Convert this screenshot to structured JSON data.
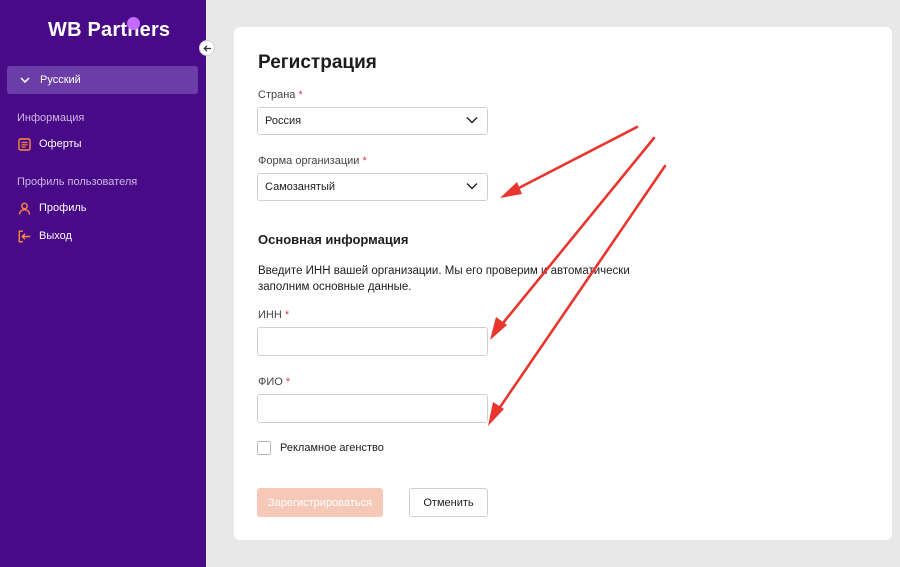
{
  "sidebar": {
    "logo_left": "WB",
    "logo_right": "Partners",
    "language": "Русский",
    "section_info": "Информация",
    "offers": "Оферты",
    "section_profile": "Профиль пользователя",
    "profile": "Профиль",
    "logout": "Выход"
  },
  "form": {
    "title": "Регистрация",
    "country_label": "Страна",
    "country_value": "Россия",
    "org_form_label": "Форма организации",
    "org_form_value": "Самозанятый",
    "section_title": "Основная информация",
    "description": "Введите ИНН вашей организации. Мы его проверим и автоматически заполним основные данные.",
    "inn_label": "ИНН",
    "inn_value": "",
    "fio_label": "ФИО",
    "fio_value": "",
    "agency_label": "Рекламное агенство",
    "submit_label": "Зарегистрироваться",
    "cancel_label": "Отменить",
    "required_mark": "*"
  },
  "colors": {
    "sidebar_bg": "#480a87",
    "accent": "#c36bff",
    "submit_disabled": "#f6c8b8",
    "annotation_arrow": "#e8362e"
  },
  "icons": [
    "collapse-arrow-icon",
    "chevron-down-icon",
    "document-icon",
    "user-icon",
    "logout-icon"
  ]
}
